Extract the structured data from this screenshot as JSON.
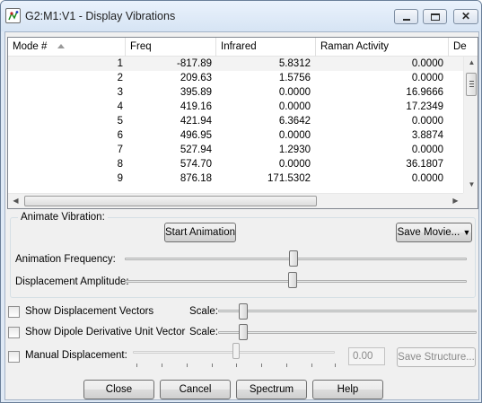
{
  "window": {
    "title": "G2:M1:V1 - Display Vibrations"
  },
  "table": {
    "headers": [
      "Mode #",
      "Freq",
      "Infrared",
      "Raman Activity",
      "De"
    ],
    "rows": [
      [
        "1",
        "-817.89",
        "5.8312",
        "0.0000"
      ],
      [
        "2",
        "209.63",
        "1.5756",
        "0.0000"
      ],
      [
        "3",
        "395.89",
        "0.0000",
        "16.9666"
      ],
      [
        "4",
        "419.16",
        "0.0000",
        "17.2349"
      ],
      [
        "5",
        "421.94",
        "6.3642",
        "0.0000"
      ],
      [
        "6",
        "496.95",
        "0.0000",
        "3.8874"
      ],
      [
        "7",
        "527.94",
        "1.2930",
        "0.0000"
      ],
      [
        "8",
        "574.70",
        "0.0000",
        "36.1807"
      ],
      [
        "9",
        "876.18",
        "171.5302",
        "0.0000"
      ]
    ]
  },
  "animate": {
    "group_label": "Animate Vibration:",
    "start_label": "Start Animation",
    "save_movie_label": "Save Movie...",
    "frequency_label": "Animation Frequency:",
    "amplitude_label": "Displacement Amplitude:"
  },
  "options": {
    "displacement_vectors_label": "Show Displacement Vectors",
    "dipole_vector_label": "Show Dipole Derivative Unit Vector",
    "scale_label": "Scale:",
    "manual_label": "Manual Displacement:",
    "manual_value": "0.00",
    "save_structure_label": "Save Structure..."
  },
  "footer": {
    "close_label": "Close",
    "cancel_label": "Cancel",
    "spectrum_label": "Spectrum",
    "help_label": "Help"
  }
}
